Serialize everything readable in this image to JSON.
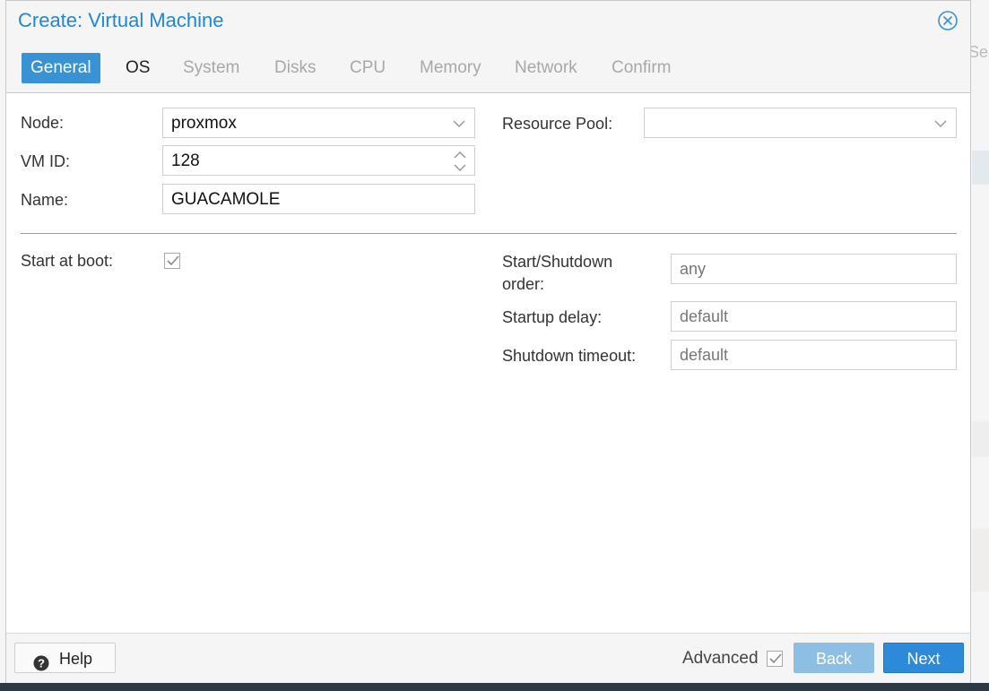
{
  "dialog": {
    "title": "Create: Virtual Machine"
  },
  "background": {
    "search_fragment": "Sea"
  },
  "tabs": [
    {
      "label": "General",
      "state": "active"
    },
    {
      "label": "OS",
      "state": "enabled"
    },
    {
      "label": "System",
      "state": "disabled"
    },
    {
      "label": "Disks",
      "state": "disabled"
    },
    {
      "label": "CPU",
      "state": "disabled"
    },
    {
      "label": "Memory",
      "state": "disabled"
    },
    {
      "label": "Network",
      "state": "disabled"
    },
    {
      "label": "Confirm",
      "state": "disabled"
    }
  ],
  "form": {
    "node": {
      "label": "Node:",
      "value": "proxmox"
    },
    "vmid": {
      "label": "VM ID:",
      "value": "128"
    },
    "name": {
      "label": "Name:",
      "value": "GUACAMOLE"
    },
    "resource_pool": {
      "label": "Resource Pool:",
      "value": ""
    },
    "start_at_boot": {
      "label": "Start at boot:",
      "checked": true
    },
    "startup_order": {
      "label_line1": "Start/Shutdown",
      "label_line2": "order:",
      "placeholder": "any"
    },
    "startup_delay": {
      "label": "Startup delay:",
      "placeholder": "default"
    },
    "shutdown_timeout": {
      "label": "Shutdown timeout:",
      "placeholder": "default"
    }
  },
  "footer": {
    "help_label": "Help",
    "advanced_label": "Advanced",
    "advanced_checked": true,
    "back_label": "Back",
    "back_disabled": true,
    "next_label": "Next"
  },
  "colors": {
    "accent": "#3892d4",
    "title": "#1e88d4",
    "next_button": "#2d8ad8",
    "back_button_disabled": "#8dbee3"
  }
}
